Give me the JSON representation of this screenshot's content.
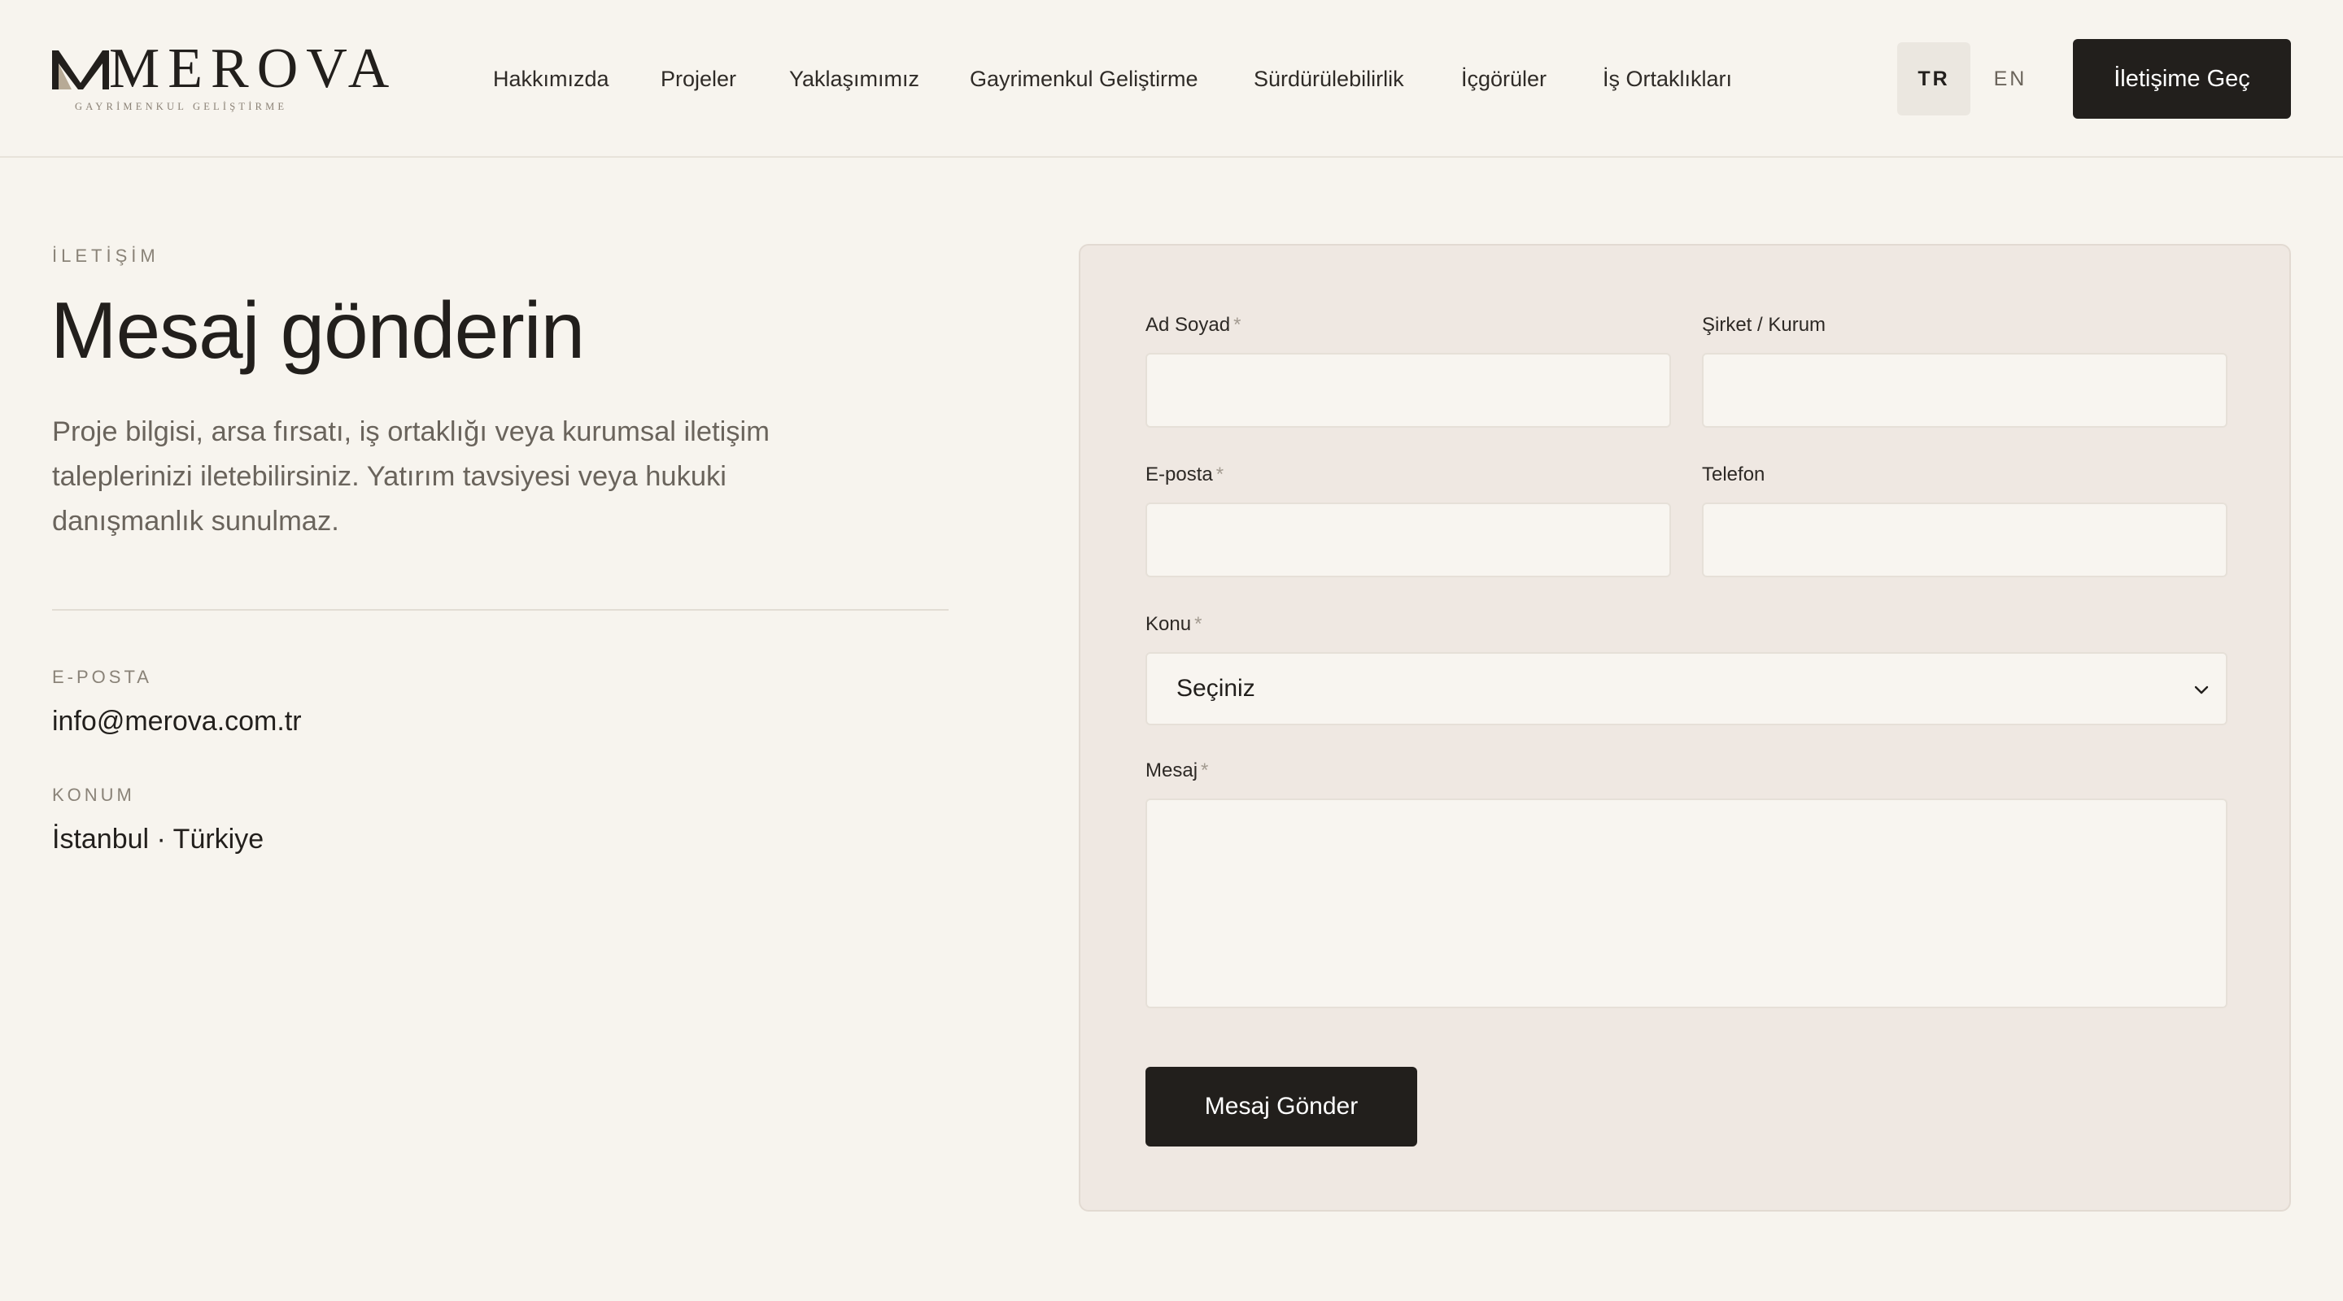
{
  "brand": {
    "name": "MEROVA",
    "tagline": "GAYRİMENKUL GELİŞTİRME"
  },
  "nav": {
    "items": [
      {
        "label": "Hakkımızda"
      },
      {
        "label": "Projeler"
      },
      {
        "label": "Yaklaşımımız"
      },
      {
        "label": "Gayrimenkul Geliştirme"
      },
      {
        "label": "Sürdürülebilirlik"
      },
      {
        "label": "İçgörüler"
      },
      {
        "label": "İş Ortaklıkları"
      }
    ]
  },
  "language": {
    "options": [
      "TR",
      "EN"
    ],
    "selected": "TR"
  },
  "header_cta": {
    "label": "İletişime Geç"
  },
  "contact": {
    "eyebrow": "İLETİŞİM",
    "title": "Mesaj gönderin",
    "intro": "Proje bilgisi, arsa fırsatı, iş ortaklığı veya kurumsal iletişim taleplerinizi iletebilirsiniz. Yatırım tavsiyesi veya hukuki danışmanlık sunulmaz.",
    "email_label": "E-POSTA",
    "email_value": "info@merova.com.tr",
    "location_label": "KONUM",
    "location_value": "İstanbul · Türkiye"
  },
  "form": {
    "required_mark": "*",
    "fields": {
      "name": {
        "label": "Ad Soyad",
        "value": "",
        "required": true
      },
      "company": {
        "label": "Şirket / Kurum",
        "value": "",
        "required": false
      },
      "email": {
        "label": "E-posta",
        "value": "",
        "required": true
      },
      "phone": {
        "label": "Telefon",
        "value": "",
        "required": false
      },
      "subject": {
        "label": "Konu",
        "selected": "Seçiniz",
        "required": true
      },
      "message": {
        "label": "Mesaj",
        "value": "",
        "required": true
      }
    },
    "submit_label": "Mesaj Gönder"
  },
  "colors": {
    "background": "#f7f4ee",
    "card_background": "#efe8e2",
    "primary_dark": "#221f1c",
    "muted_text": "#6a645c"
  }
}
